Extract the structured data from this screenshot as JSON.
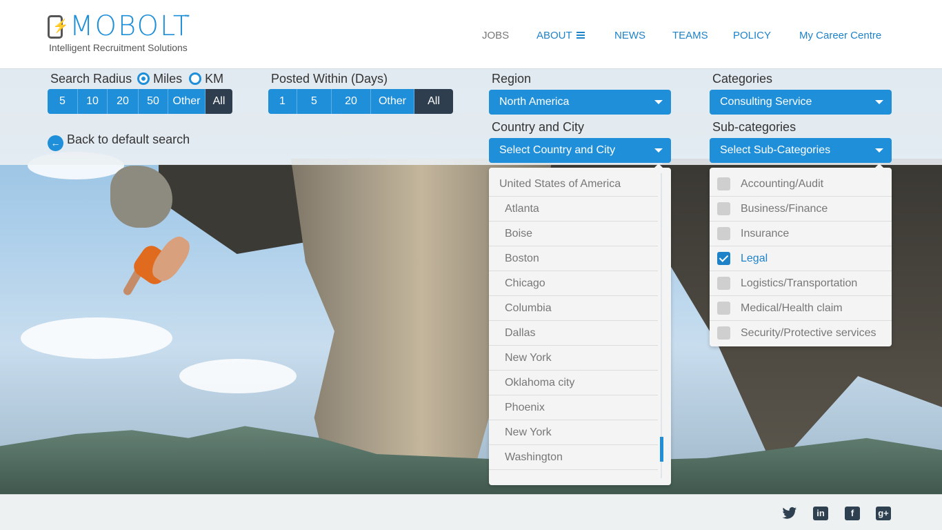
{
  "brand": {
    "name": "MOBOLT",
    "trademark": "™",
    "tagline": "Intelligent Recruitment Solutions"
  },
  "nav": {
    "jobs": "JOBS",
    "about": "ABOUT",
    "news": "NEWS",
    "teams": "TEAMS",
    "policy": "POLICY",
    "career": "My Career Centre"
  },
  "filters": {
    "radius": {
      "label": "Search Radius",
      "unit_miles": "Miles",
      "unit_km": "KM",
      "selected_unit": "Miles",
      "options": [
        "5",
        "10",
        "20",
        "50",
        "Other",
        "All"
      ],
      "selected": "All"
    },
    "posted": {
      "label": "Posted Within (Days)",
      "options": [
        "1",
        "5",
        "20",
        "Other",
        "All"
      ],
      "selected": "All"
    },
    "back_link": "Back to default search",
    "region": {
      "label": "Region",
      "value": "North America"
    },
    "country_city": {
      "label": "Country and City",
      "placeholder": "Select Country  and City",
      "group": "United States of America",
      "cities": [
        "Atlanta",
        "Boise",
        "Boston",
        "Chicago",
        "Columbia",
        "Dallas",
        "New York",
        "Oklahoma city",
        "Phoenix",
        "New York",
        "Washington"
      ]
    },
    "categories": {
      "label": "Categories",
      "value": "Consulting Service"
    },
    "subcategories": {
      "label": "Sub-categories",
      "placeholder": "Select Sub-Categories",
      "items": [
        {
          "label": "Accounting/Audit",
          "checked": false
        },
        {
          "label": "Business/Finance",
          "checked": false
        },
        {
          "label": "Insurance",
          "checked": false
        },
        {
          "label": "Legal",
          "checked": true
        },
        {
          "label": "Logistics/Transportation",
          "checked": false
        },
        {
          "label": "Medical/Health claim",
          "checked": false
        },
        {
          "label": "Security/Protective services",
          "checked": false
        }
      ]
    }
  },
  "footer": {
    "social": [
      "twitter-icon",
      "linkedin-icon",
      "facebook-icon",
      "google-plus-icon"
    ]
  },
  "colors": {
    "accent": "#1e8fd8",
    "active": "#2e3e4e",
    "panel": "#f4f4f4"
  }
}
